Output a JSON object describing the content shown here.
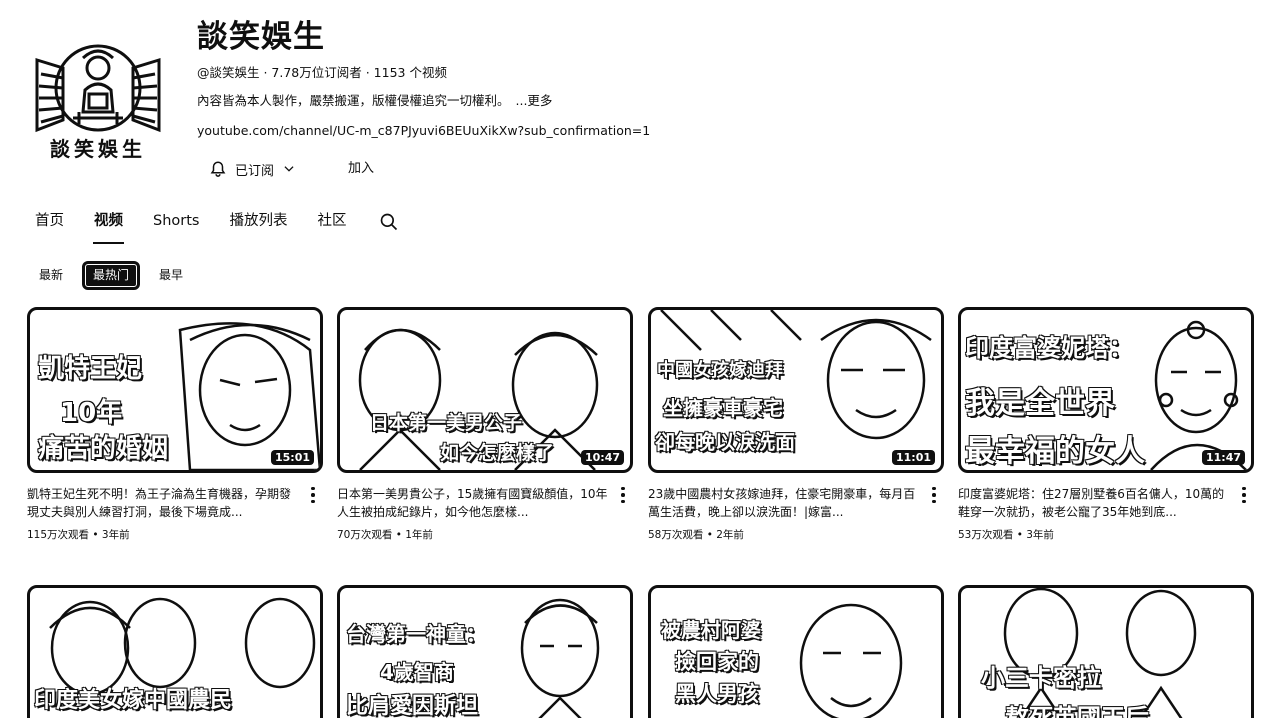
{
  "channel": {
    "name": "談笑娛生",
    "avatar_text": "談笑娛生",
    "meta": "@談笑娛生 · 7.78万位订阅者 · 1153 个视频",
    "description": "內容皆為本人製作，嚴禁搬運，版權侵權追究一切權利。",
    "more_label": "...更多",
    "link": "youtube.com/channel/UC-m_c87PJyuvi6BEUuXikXw?sub_confirmation=1",
    "subscribe_label": "已订阅",
    "join_label": "加入"
  },
  "tabs": [
    {
      "label": "首页"
    },
    {
      "label": "视频"
    },
    {
      "label": "Shorts"
    },
    {
      "label": "播放列表"
    },
    {
      "label": "社区"
    }
  ],
  "sort_chips": [
    {
      "label": "最新"
    },
    {
      "label": "最热门"
    },
    {
      "label": "最早"
    }
  ],
  "videos": [
    {
      "title": "凱特王妃生死不明！為王子淪為生育機器，孕期發現丈夫與別人練習打洞，最後下場竟成...",
      "views": "115万次观看",
      "age": "3年前",
      "duration": "15:01",
      "overlay": [
        "凱特王妃",
        "10年",
        "痛苦的婚姻"
      ]
    },
    {
      "title": "日本第一美男貴公子，15歲擁有國寶級顏值，10年人生被拍成紀錄片，如今他怎麼樣...",
      "views": "70万次观看",
      "age": "1年前",
      "duration": "10:47",
      "overlay": [
        "日本第一美男公子",
        "如今怎麼樣了"
      ]
    },
    {
      "title": "23歲中國農村女孩嫁迪拜，住豪宅開豪車，每月百萬生活費，晚上卻以淚洗面！|嫁富...",
      "views": "58万次观看",
      "age": "2年前",
      "duration": "11:01",
      "overlay": [
        "中國女孩嫁迪拜",
        "坐擁豪車豪宅",
        "卻每晚以淚洗面"
      ]
    },
    {
      "title": "印度富婆妮塔：住27層別墅養6百名傭人，10萬的鞋穿一次就扔，被老公寵了35年她到底...",
      "views": "53万次观看",
      "age": "3年前",
      "duration": "11:47",
      "overlay": [
        "印度富婆妮塔：",
        "我是全世界",
        "最幸福的女人"
      ]
    },
    {
      "overlay": [
        "印度美女嫁中國農民"
      ]
    },
    {
      "overlay": [
        "台灣第一神童：",
        "4歲智商",
        "比肩愛因斯坦"
      ]
    },
    {
      "overlay": [
        "被農村阿婆",
        "撿回家的",
        "黑人男孩"
      ]
    },
    {
      "overlay": [
        "小三卡密拉",
        "熬死英國王后"
      ]
    }
  ]
}
